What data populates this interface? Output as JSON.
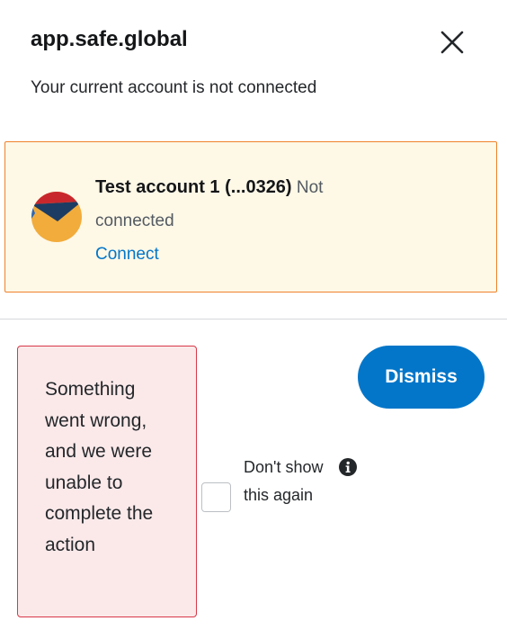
{
  "header": {
    "title": "app.safe.global",
    "close_icon": "close-icon"
  },
  "subtitle": "Your current account is not connected",
  "account": {
    "name": "Test account 1 (...0326)",
    "status": "Not connected",
    "connect_label": "Connect",
    "avatar_icon": "account-avatar-icon"
  },
  "error": {
    "message": "Something went wrong, and we were unable to complete the action"
  },
  "dont_show": {
    "label": "Don't show this again",
    "checked": false,
    "info_icon": "info-icon"
  },
  "actions": {
    "dismiss_label": "Dismiss"
  },
  "colors": {
    "primary": "#0376c9",
    "warning_border": "#f0822b",
    "warning_bg": "#fef8e7",
    "error_border": "#d73847",
    "error_bg": "#fbe9ea"
  }
}
